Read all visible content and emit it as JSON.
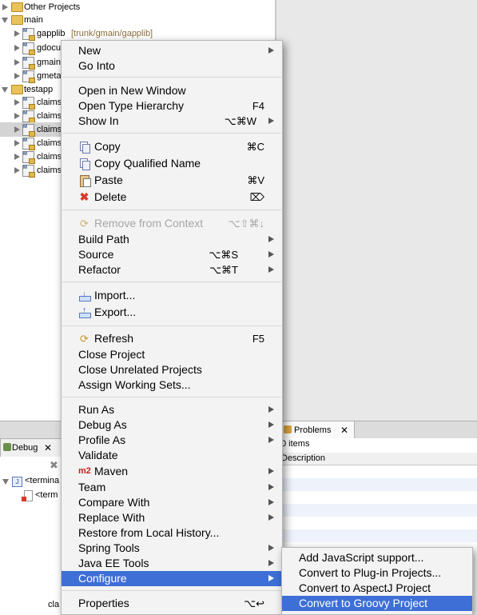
{
  "explorer": {
    "rows": [
      {
        "label": "Other Projects",
        "deco": ""
      },
      {
        "label": "main",
        "deco": ""
      },
      {
        "label": "gapplib",
        "deco": "[trunk/gmain/gapplib]"
      },
      {
        "label": "gdocu",
        "deco": ""
      },
      {
        "label": "gmain",
        "deco": ""
      },
      {
        "label": "gmeta",
        "deco": ""
      },
      {
        "label": "testapp",
        "deco": ""
      },
      {
        "label": "claims",
        "deco": ""
      },
      {
        "label": "claims",
        "deco": ""
      },
      {
        "label": "claims",
        "deco": ""
      },
      {
        "label": "claims",
        "deco": ""
      },
      {
        "label": "claims",
        "deco": ""
      },
      {
        "label": "claims",
        "deco": ""
      }
    ]
  },
  "panels": {
    "debug_tab": "Debug",
    "debug_row1": "<termina",
    "debug_row2": "<term",
    "debug_bottom": "cla",
    "problems_tab": "Problems",
    "problems_count": "0 items",
    "problems_col": "Description"
  },
  "menu": {
    "items": [
      {
        "label": "New"
      },
      {
        "label": "Go Into"
      },
      {
        "label": "Open in New Window"
      },
      {
        "label": "Open Type Hierarchy",
        "shortcut": "F4"
      },
      {
        "label": "Show In",
        "shortcut": "⌥⌘W"
      },
      {
        "label": "Copy",
        "shortcut": "⌘C",
        "icon": "copy-icon"
      },
      {
        "label": "Copy Qualified Name",
        "icon": "copy-qualified-icon"
      },
      {
        "label": "Paste",
        "shortcut": "⌘V",
        "icon": "paste-icon"
      },
      {
        "label": "Delete",
        "shortcut": "⌦",
        "icon": "delete-icon"
      },
      {
        "label": "Remove from Context",
        "shortcut": "⌥⇧⌘↓",
        "icon": "remove-context-icon"
      },
      {
        "label": "Build Path"
      },
      {
        "label": "Source",
        "shortcut": "⌥⌘S"
      },
      {
        "label": "Refactor",
        "shortcut": "⌥⌘T"
      },
      {
        "label": "Import...",
        "icon": "import-icon"
      },
      {
        "label": "Export...",
        "icon": "export-icon"
      },
      {
        "label": "Refresh",
        "shortcut": "F5",
        "icon": "refresh-icon"
      },
      {
        "label": "Close Project"
      },
      {
        "label": "Close Unrelated Projects"
      },
      {
        "label": "Assign Working Sets..."
      },
      {
        "label": "Run As"
      },
      {
        "label": "Debug As"
      },
      {
        "label": "Profile As"
      },
      {
        "label": "Validate"
      },
      {
        "label": "Maven",
        "icon_text": "m2"
      },
      {
        "label": "Team"
      },
      {
        "label": "Compare With"
      },
      {
        "label": "Replace With"
      },
      {
        "label": "Restore from Local History..."
      },
      {
        "label": "Spring Tools"
      },
      {
        "label": "Java EE Tools"
      },
      {
        "label": "Configure"
      },
      {
        "label": "Properties",
        "shortcut": "⌥↩"
      }
    ]
  },
  "submenu": {
    "items": [
      {
        "label": "Add JavaScript support..."
      },
      {
        "label": "Convert to Plug-in Projects..."
      },
      {
        "label": "Convert to AspectJ Project"
      },
      {
        "label": "Convert to Groovy Project"
      }
    ]
  },
  "colors": {
    "highlight": "#3d6fd6",
    "menu_bg": "#f3f3f3",
    "maven_icon": "#c81e1e",
    "delete_icon": "#d83a2b"
  }
}
